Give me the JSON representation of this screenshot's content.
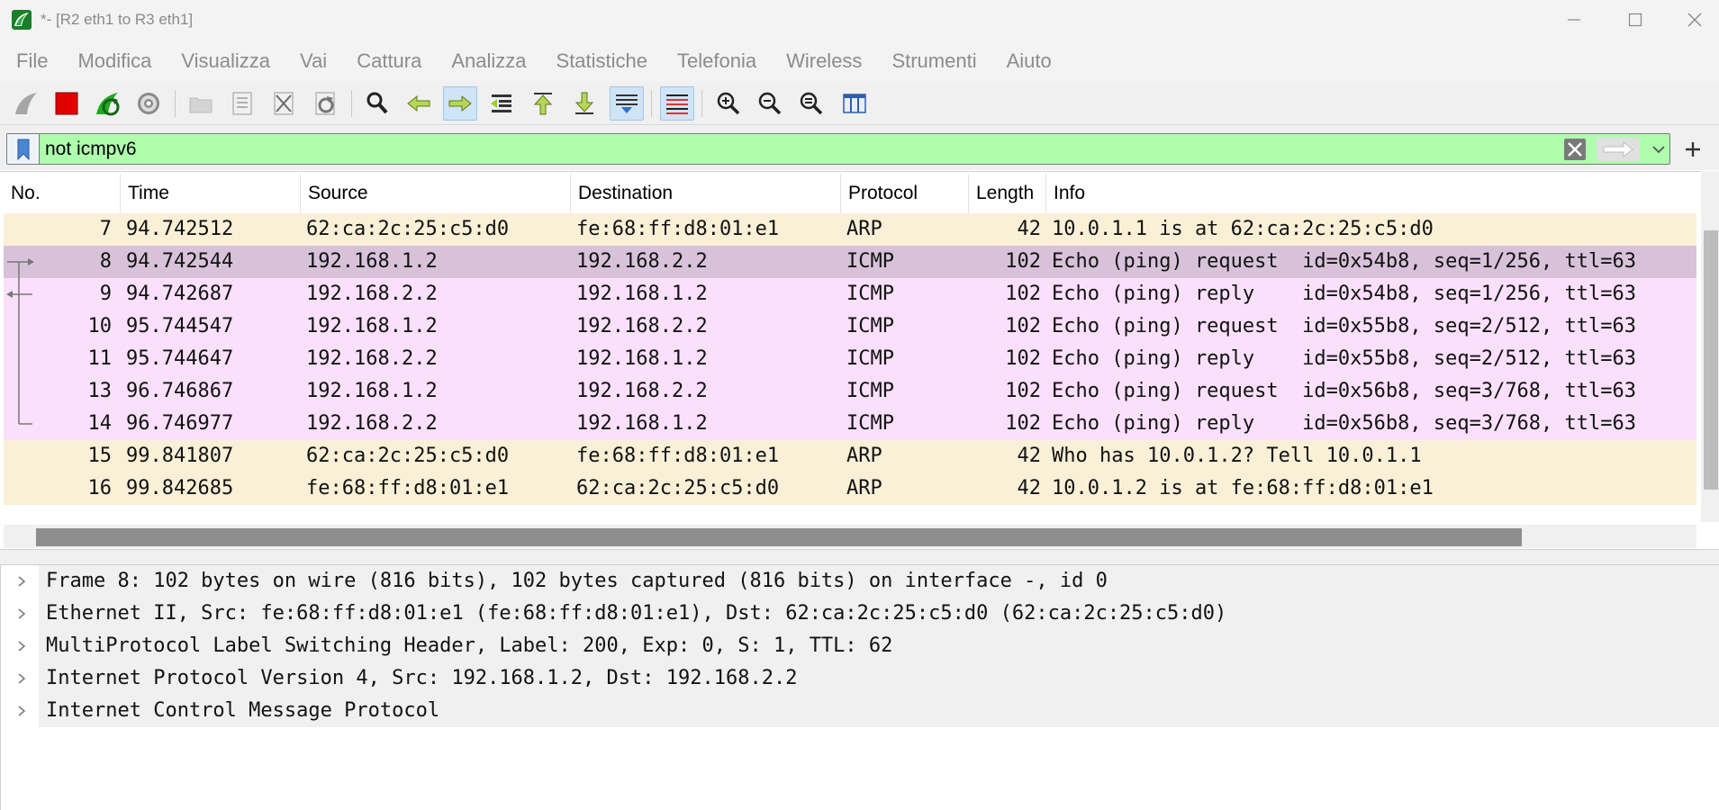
{
  "window": {
    "title": "*- [R2 eth1 to R3 eth1]"
  },
  "menu": [
    "File",
    "Modifica",
    "Visualizza",
    "Vai",
    "Cattura",
    "Analizza",
    "Statistiche",
    "Telefonia",
    "Wireless",
    "Strumenti",
    "Aiuto"
  ],
  "toolbar": {
    "icons": [
      "shark-fin-start-icon",
      "stop-square-icon",
      "restart-capture-icon",
      "capture-options-gear-icon",
      "open-folder-icon",
      "save-file-icon",
      "close-file-icon",
      "reload-icon",
      "find-magnifier-icon",
      "go-back-arrow-icon",
      "go-forward-arrow-icon",
      "go-to-packet-icon",
      "first-packet-icon",
      "last-packet-icon",
      "autoscroll-icon",
      "colorize-icon",
      "zoom-in-icon",
      "zoom-out-icon",
      "zoom-reset-icon",
      "resize-columns-icon"
    ],
    "active": [
      "go-forward-arrow-icon",
      "autoscroll-icon",
      "colorize-icon"
    ]
  },
  "filter": {
    "value": "not icmpv6",
    "bg_color": "#aefeae"
  },
  "packet_list": {
    "columns": [
      "No.",
      "Time",
      "Source",
      "Destination",
      "Protocol",
      "Length",
      "Info"
    ],
    "rows": [
      {
        "no": "7",
        "time": "94.742512",
        "source": "62:ca:2c:25:c5:d0",
        "destination": "fe:68:ff:d8:01:e1",
        "protocol": "ARP",
        "length": "42",
        "info": "10.0.1.1 is at 62:ca:2c:25:c5:d0",
        "color": "#faf0d7",
        "related": ""
      },
      {
        "no": "8",
        "time": "94.742544",
        "source": "192.168.1.2",
        "destination": "192.168.2.2",
        "protocol": "ICMP",
        "length": "102",
        "info": "Echo (ping) request  id=0x54b8, seq=1/256, ttl=63",
        "color": "#d8c2da",
        "related": "request"
      },
      {
        "no": "9",
        "time": "94.742687",
        "source": "192.168.2.2",
        "destination": "192.168.1.2",
        "protocol": "ICMP",
        "length": "102",
        "info": "Echo (ping) reply    id=0x54b8, seq=1/256, ttl=63",
        "color": "#fbe0fc",
        "related": "reply"
      },
      {
        "no": "10",
        "time": "95.744547",
        "source": "192.168.1.2",
        "destination": "192.168.2.2",
        "protocol": "ICMP",
        "length": "102",
        "info": "Echo (ping) request  id=0x55b8, seq=2/512, ttl=63",
        "color": "#fbe0fc",
        "related": "line"
      },
      {
        "no": "11",
        "time": "95.744647",
        "source": "192.168.2.2",
        "destination": "192.168.1.2",
        "protocol": "ICMP",
        "length": "102",
        "info": "Echo (ping) reply    id=0x55b8, seq=2/512, ttl=63",
        "color": "#fbe0fc",
        "related": "line"
      },
      {
        "no": "13",
        "time": "96.746867",
        "source": "192.168.1.2",
        "destination": "192.168.2.2",
        "protocol": "ICMP",
        "length": "102",
        "info": "Echo (ping) request  id=0x56b8, seq=3/768, ttl=63",
        "color": "#fbe0fc",
        "related": "line"
      },
      {
        "no": "14",
        "time": "96.746977",
        "source": "192.168.2.2",
        "destination": "192.168.1.2",
        "protocol": "ICMP",
        "length": "102",
        "info": "Echo (ping) reply    id=0x56b8, seq=3/768, ttl=63",
        "color": "#fbe0fc",
        "related": "end"
      },
      {
        "no": "15",
        "time": "99.841807",
        "source": "62:ca:2c:25:c5:d0",
        "destination": "fe:68:ff:d8:01:e1",
        "protocol": "ARP",
        "length": "42",
        "info": "Who has 10.0.1.2? Tell 10.0.1.1",
        "color": "#faf0d7",
        "related": ""
      },
      {
        "no": "16",
        "time": "99.842685",
        "source": "fe:68:ff:d8:01:e1",
        "destination": "62:ca:2c:25:c5:d0",
        "protocol": "ARP",
        "length": "42",
        "info": "10.0.1.2 is at fe:68:ff:d8:01:e1",
        "color": "#faf0d7",
        "related": ""
      }
    ]
  },
  "details": [
    "Frame 8: 102 bytes on wire (816 bits), 102 bytes captured (816 bits) on interface -, id 0",
    "Ethernet II, Src: fe:68:ff:d8:01:e1 (fe:68:ff:d8:01:e1), Dst: 62:ca:2c:25:c5:d0 (62:ca:2c:25:c5:d0)",
    "MultiProtocol Label Switching Header, Label: 200, Exp: 0, S: 1, TTL: 62",
    "Internet Protocol Version 4, Src: 192.168.1.2, Dst: 192.168.2.2",
    "Internet Control Message Protocol"
  ]
}
